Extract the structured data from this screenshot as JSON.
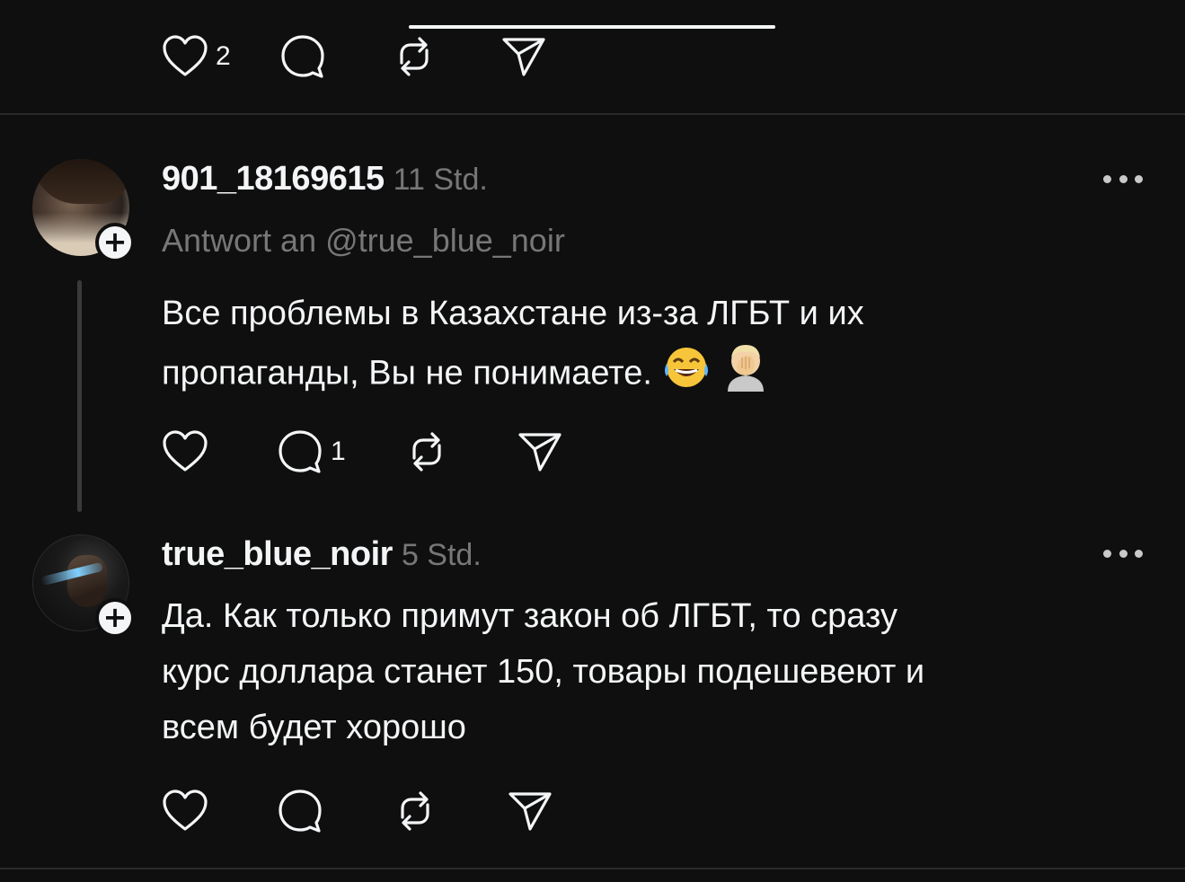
{
  "top_post": {
    "like_count": "2"
  },
  "posts": [
    {
      "username": "901_18169615",
      "time": "11 Std.",
      "reply_to": "Antwort an @true_blue_noir",
      "text": "Все проблемы в Казахстане из-за ЛГБТ и их\nпропаганды, Вы не понимаете.",
      "emojis": [
        "joy-emoji",
        "facepalm-emoji"
      ],
      "reply_count": "1"
    },
    {
      "username": "true_blue_noir",
      "time": "5 Std.",
      "text": "Да. Как только примут закон об ЛГБТ, то сразу\nкурс доллара станет 150, товары подешевеют и\nвсем будет хорошо"
    }
  ],
  "icons": {
    "like": "heart-icon",
    "reply": "comment-icon",
    "repost": "repost-icon",
    "share": "send-icon",
    "more": "more-dots-icon",
    "follow": "plus-icon"
  },
  "colors": {
    "background": "#0f0f0f",
    "text": "#f3f5f7",
    "secondary": "#777777",
    "divider": "#2a2a2a"
  }
}
